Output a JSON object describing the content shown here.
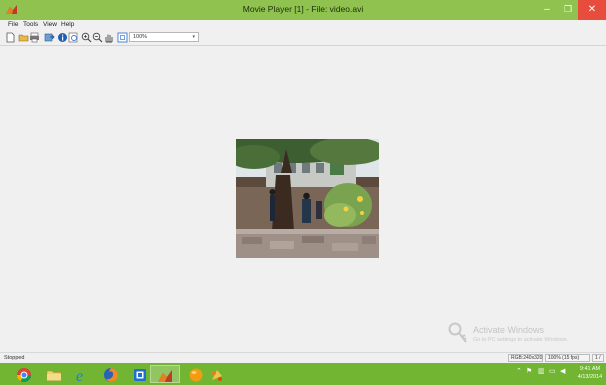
{
  "window": {
    "title": "Movie Player [1] - File: video.avi",
    "controls": {
      "minimize": "–",
      "maximize": "❐",
      "close": "✕"
    }
  },
  "menu": [
    "File",
    "Tools",
    "View",
    "Help"
  ],
  "toolbar": {
    "buttons": [
      "new-file-icon",
      "open-folder-icon",
      "print-icon",
      "export-icon",
      "info-icon",
      "frame-icon",
      "zoom-in-icon",
      "zoom-out-icon",
      "pan-hand-icon",
      "fit-window-icon"
    ],
    "zoom_value": "100%",
    "zoom_arrow": "▾"
  },
  "video": {
    "file": "video.avi"
  },
  "watermark": {
    "title": "Activate Windows",
    "subtitle": "Go to PC settings to activate Windows."
  },
  "status": {
    "state": "Stopped",
    "format": "RGB:240x320",
    "zoom_fps": "100% (15 fps)",
    "frame": "1 /"
  },
  "taskbar": {
    "items": [
      "chrome",
      "file-explorer",
      "internet-explorer",
      "firefox",
      "media-app",
      "matlab",
      "orange-app",
      "paint-app"
    ],
    "clock_time": "9:41 AM",
    "clock_date": "4/13/2014"
  },
  "colors": {
    "title_bar": "#8fc24f",
    "taskbar": "#71b532",
    "close_button": "#e74c3c",
    "canvas": "#f0f0f0"
  }
}
